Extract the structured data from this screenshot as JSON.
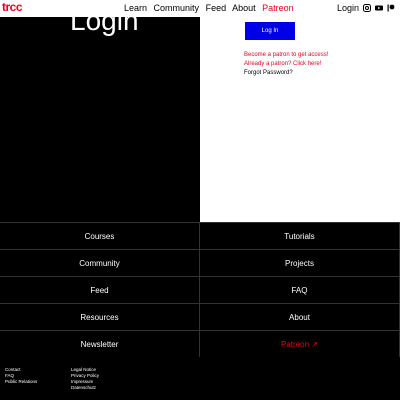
{
  "header": {
    "logo": "trcc",
    "nav": [
      "Learn",
      "Community",
      "Feed",
      "About",
      "Patreon"
    ],
    "login": "Login"
  },
  "hero": {
    "title": "Login",
    "login_button": "Log In",
    "become_patron": "Become a patron to get access!",
    "already_patron": "Already a patron? Click here!",
    "forgot_password": "Forgot Password?"
  },
  "grid": [
    "Courses",
    "Tutorials",
    "Community",
    "Projects",
    "Feed",
    "FAQ",
    "Resources",
    "About",
    "Newsletter",
    "Patreon ↗"
  ],
  "footer": {
    "col1": [
      "Contact",
      "FAQ",
      "Public Relations"
    ],
    "col2": [
      "Legal Notice",
      "Privacy Policy",
      "Impressum",
      "Datenschutz"
    ]
  },
  "colors": {
    "accent": "#e8001c",
    "button": "#0000e6"
  }
}
